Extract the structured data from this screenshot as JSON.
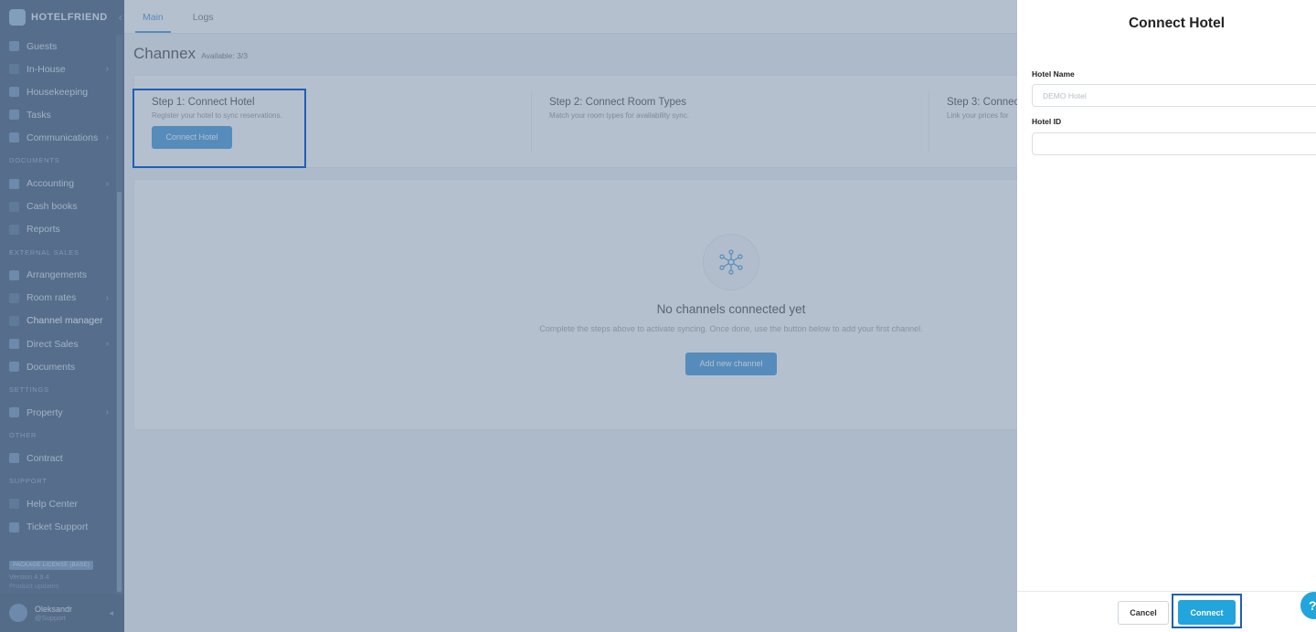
{
  "app": {
    "logo_text": "HOTELFRIEND",
    "collapse_glyph": "‹"
  },
  "sidebar": {
    "items": [
      {
        "label": "Guests",
        "icon": "user-icon",
        "chevron": false
      },
      {
        "label": "In-House",
        "icon": "bed-icon",
        "chevron": true
      },
      {
        "label": "Housekeeping",
        "icon": "broom-icon",
        "chevron": false
      },
      {
        "label": "Tasks",
        "icon": "tools-icon",
        "chevron": false
      },
      {
        "label": "Communications",
        "icon": "message-icon",
        "chevron": true
      }
    ],
    "section_documents": "DOCUMENTS",
    "documents_items": [
      {
        "label": "Accounting",
        "icon": "chart-icon",
        "chevron": true
      },
      {
        "label": "Cash books",
        "icon": "book-icon",
        "chevron": false
      },
      {
        "label": "Reports",
        "icon": "clock-icon",
        "chevron": false
      }
    ],
    "section_external": "EXTERNAL SALES",
    "external_items": [
      {
        "label": "Arrangements",
        "icon": "tag-icon",
        "chevron": false
      },
      {
        "label": "Room rates",
        "icon": "graph-icon",
        "chevron": true
      },
      {
        "label": "Channel manager",
        "icon": "network-icon",
        "chevron": false
      },
      {
        "label": "Direct Sales",
        "icon": "store-icon",
        "chevron": true
      },
      {
        "label": "Documents",
        "icon": "folder-icon",
        "chevron": false
      }
    ],
    "section_settings": "SETTINGS",
    "settings_items": [
      {
        "label": "Property",
        "icon": "gear-icon",
        "chevron": true
      }
    ],
    "section_other": "OTHER",
    "other_items": [
      {
        "label": "Contract",
        "icon": "document-icon",
        "chevron": false
      }
    ],
    "section_support": "SUPPORT",
    "support_items": [
      {
        "label": "Help Center",
        "icon": "link-icon",
        "chevron": false
      },
      {
        "label": "Ticket Support",
        "icon": "ticket-icon",
        "chevron": false
      }
    ],
    "license_badge": "PACKAGE LICENSE (BASE)",
    "version": "Version 4.9.4",
    "updates_link": "Product updates",
    "user": {
      "name": "Oleksandr",
      "role": "@Support",
      "arrow": "◂"
    }
  },
  "main": {
    "tabs": [
      "Main",
      "Logs"
    ],
    "title": "Channex",
    "subtitle": "Available: 3/3",
    "steps": [
      {
        "title": "Step 1: Connect Hotel",
        "desc": "Register your hotel to sync reservations.",
        "button": "Connect Hotel"
      },
      {
        "title": "Step 2: Connect Room Types",
        "desc": "Match your room types for availability sync."
      },
      {
        "title": "Step 3: Connec",
        "desc": "Link your prices for"
      }
    ],
    "empty": {
      "title": "No channels connected yet",
      "desc": "Complete the steps above to activate syncing. Once done, use the button below to add your first channel.",
      "button": "Add new channel"
    }
  },
  "drawer": {
    "title": "Connect Hotel",
    "hotel_name_label": "Hotel Name",
    "hotel_name_placeholder": "DEMO Hotel",
    "hotel_id_label": "Hotel ID",
    "hotel_id_value": "",
    "cancel": "Cancel",
    "connect": "Connect",
    "help": "?"
  },
  "colors": {
    "accent": "#22a4dc",
    "sidebar_bg": "#2d4a6b",
    "highlight": "#1f5fb8"
  }
}
